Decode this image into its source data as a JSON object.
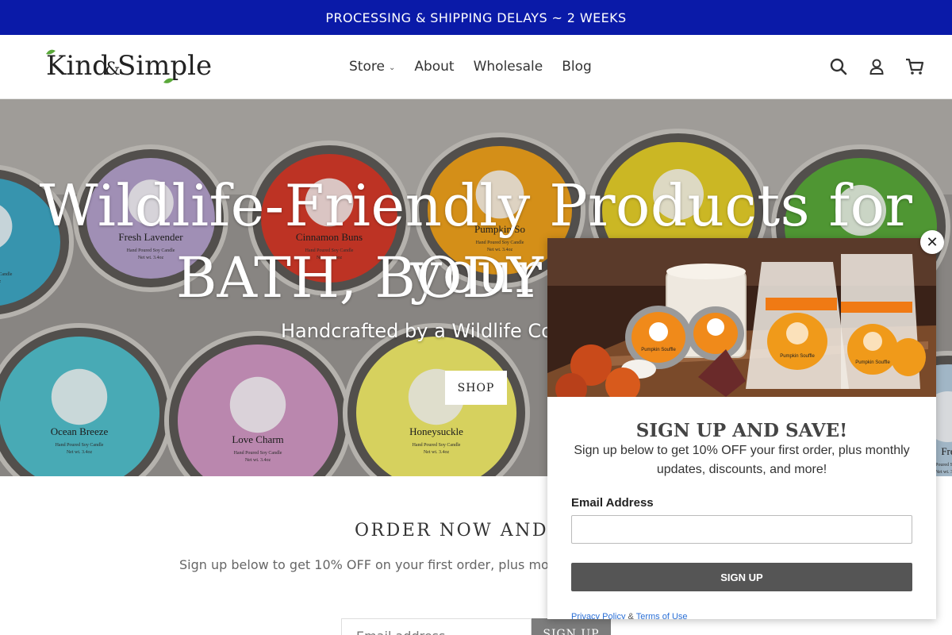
{
  "announcement": "PROCESSING & SHIPPING DELAYS ~ 2 WEEKS",
  "brand": {
    "logo_text_1": "Kind",
    "logo_amp": "&",
    "logo_text_2": "Simple",
    "leaf_color": "#5aa83a"
  },
  "nav": {
    "items": [
      {
        "label": "Store",
        "has_dropdown": true
      },
      {
        "label": "About"
      },
      {
        "label": "Wholesale"
      },
      {
        "label": "Blog"
      }
    ]
  },
  "header_icons": [
    "search-icon",
    "account-icon",
    "cart-icon"
  ],
  "hero": {
    "title_line1": "Wildlife-Friendly Products for your",
    "title_line2": "BATH, BODY &",
    "subtitle": "Handcrafted by a Wildlife Co",
    "shop_label": "SHOP",
    "tins": [
      {
        "label": "nen",
        "color": "#3fa9c7"
      },
      {
        "label": "Fresh Lavender",
        "color": "#b7a3cf"
      },
      {
        "label": "Cinnamon Buns",
        "color": "#d83b2a"
      },
      {
        "label": "Pumpkin So",
        "color": "#f2a31c"
      },
      {
        "label": "",
        "color": "#e8d12a"
      },
      {
        "label": "",
        "color": "#5aab3b"
      },
      {
        "label": "Ocean Breeze",
        "color": "#53c2cf"
      },
      {
        "label": "Love Charm",
        "color": "#d49ac6"
      },
      {
        "label": "Honeysuckle",
        "color": "#f4ee6c"
      },
      {
        "label": "Fre",
        "color": "#b8d0e2"
      }
    ],
    "tin_sublabel": "Hand Poured Soy Candle",
    "tin_weight": "Net wt. 3.4oz"
  },
  "order": {
    "title": "ORDER NOW AND S",
    "subtitle": "Sign up below to get 10% OFF on your first order, plus mo",
    "email_placeholder": "Email address",
    "button_label": "SIGN UP"
  },
  "popup": {
    "title": "SIGN UP AND SAVE!",
    "description": "Sign up below to get 10% OFF your first order, plus monthly updates, discounts, and more!",
    "email_label": "Email Address",
    "email_value": "",
    "button_label": "SIGN UP",
    "privacy_label": "Privacy Policy",
    "amp": "&",
    "terms_label": "Terms of Use",
    "close_glyph": "✕",
    "candle_labels": [
      "Pumpkin Souffle",
      "Pumpkin Souffle",
      "Pumpkin Souffle"
    ]
  },
  "colors": {
    "announcement_bg": "#0a1aa8",
    "popup_button": "#555555",
    "order_button": "#7d7d7d"
  }
}
